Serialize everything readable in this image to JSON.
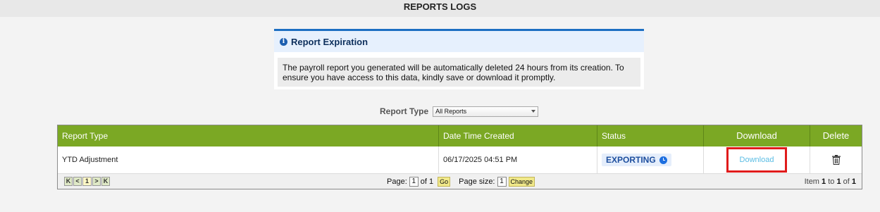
{
  "header": {
    "title": "REPORTS LOGS"
  },
  "notice": {
    "title": "Report Expiration",
    "body": "The payroll report you generated will be automatically deleted 24 hours from its creation. To ensure you have access to this data, kindly save or download it promptly."
  },
  "filter": {
    "label": "Report Type",
    "selected": "All Reports"
  },
  "grid": {
    "columns": [
      "Report Type",
      "Date Time Created",
      "Status",
      "Download",
      "Delete"
    ],
    "rows": [
      {
        "report_type": "YTD Adjustment",
        "created": "06/17/2025 04:51 PM",
        "status": "EXPORTING",
        "download_label": "Download"
      }
    ]
  },
  "pager": {
    "nav": {
      "first": "K",
      "prev": "<",
      "current_page": "1",
      "next": ">",
      "last": "K"
    },
    "page_label": "Page:",
    "page_value": "1",
    "of_label": "of 1",
    "go_label": "Go",
    "page_size_label": "Page size:",
    "page_size_value": "1",
    "change_label": "Change",
    "item_prefix": "Item ",
    "item_from": "1",
    "item_to_label": " to ",
    "item_to": "1",
    "item_of_label": " of ",
    "item_total": "1"
  },
  "colors": {
    "header_green": "#7ba824",
    "highlight_red": "#e01b1b",
    "link_blue": "#5bbde4",
    "notice_blue": "#1d6fc2"
  }
}
